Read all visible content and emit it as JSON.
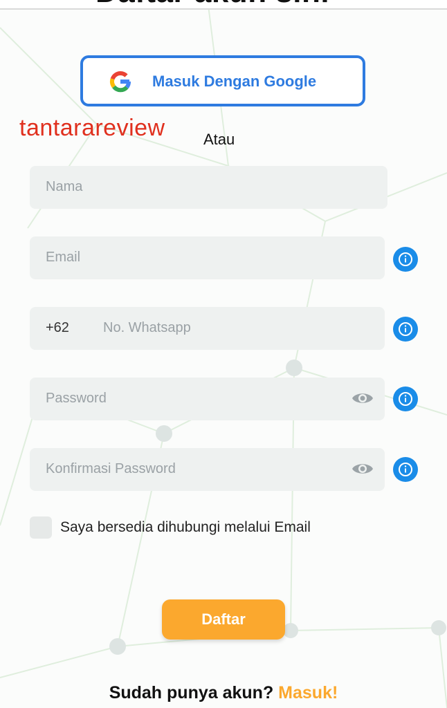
{
  "header": {
    "heading": "Daftar akun sini"
  },
  "google_button": {
    "label": "Masuk Dengan Google"
  },
  "watermark": {
    "text": "tantarareview"
  },
  "divider": {
    "text": "Atau"
  },
  "form": {
    "name": {
      "placeholder": "Nama"
    },
    "email": {
      "placeholder": "Email"
    },
    "whatsapp": {
      "prefix": "+62",
      "placeholder": "No. Whatsapp"
    },
    "password": {
      "placeholder": "Password"
    },
    "confirm_password": {
      "placeholder": "Konfirmasi Password"
    },
    "consent_label": "Saya bersedia dihubungi melalui Email",
    "consent_checked": false,
    "submit_label": "Daftar"
  },
  "footer": {
    "question": "Sudah punya akun?",
    "link_label": "Masuk!"
  },
  "icons": {
    "google": "google-g-icon",
    "info": "info-circle-icon",
    "eye": "eye-icon"
  },
  "colors": {
    "primary_blue": "#2e7be0",
    "info_blue": "#1a8ce8",
    "accent_orange": "#fba82e",
    "watermark_red": "#e0301e",
    "field_bg": "#eef1f0"
  }
}
